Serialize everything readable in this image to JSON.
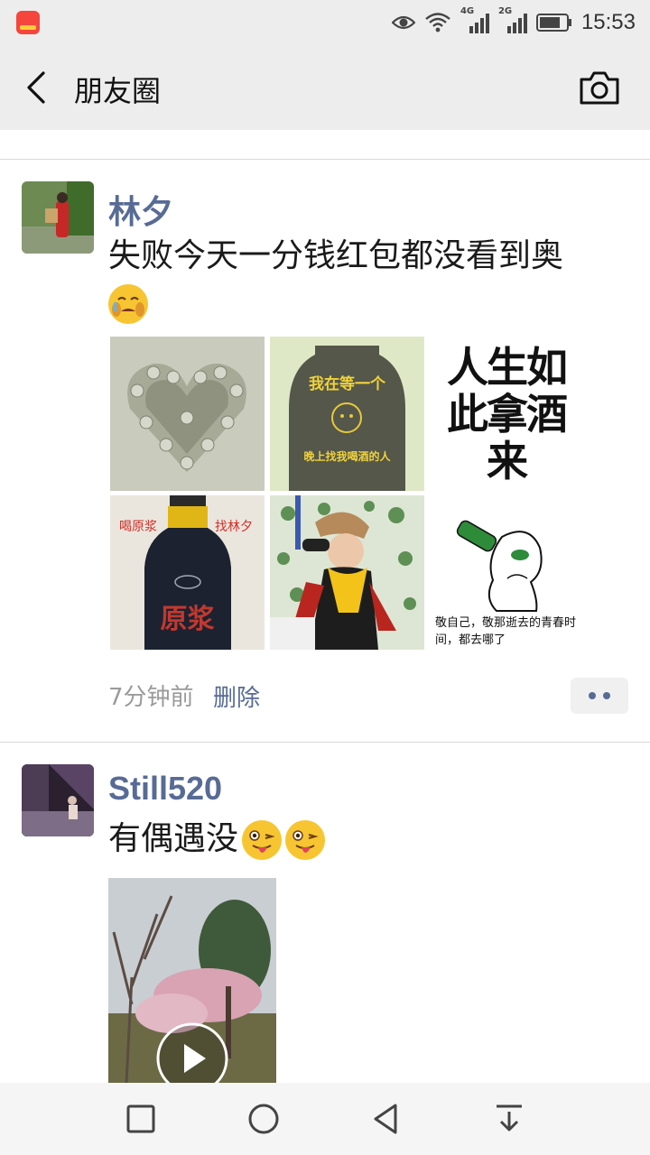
{
  "status": {
    "time": "15:53",
    "network1": "4G",
    "network2": "2G"
  },
  "header": {
    "title": "朋友圈",
    "back_icon": "back-arrow-icon",
    "camera_icon": "camera-icon"
  },
  "posts": [
    {
      "username": "林夕",
      "text": "失败今天一分钱红包都没看到奥",
      "emoji": "crying-face-emoji",
      "images": [
        {
          "name": "coin-heart-image"
        },
        {
          "name": "jar-image",
          "caption_top": "我在等一个",
          "caption_bottom": "晚上找我喝酒的人"
        },
        {
          "name": "calligraphy-image",
          "text": "人生如此拿酒来"
        },
        {
          "name": "liquor-bottle-image",
          "left_label": "喝原浆",
          "right_label": "找林夕",
          "bottle_label": "原浆"
        },
        {
          "name": "person-drinking-image"
        },
        {
          "name": "meme-drinking-image",
          "caption": "敬自己，敬那逝去的青春时间，都去哪了"
        }
      ],
      "time": "7分钟前",
      "delete_label": "删除"
    },
    {
      "username": "Still520",
      "text": "有偶遇没",
      "emoji": "winking-tongue-emoji",
      "video": {
        "name": "blossom-video-thumbnail"
      }
    }
  ],
  "colors": {
    "link": "#576b95",
    "bar": "#ededed",
    "navbar": "#f5f5f5"
  }
}
